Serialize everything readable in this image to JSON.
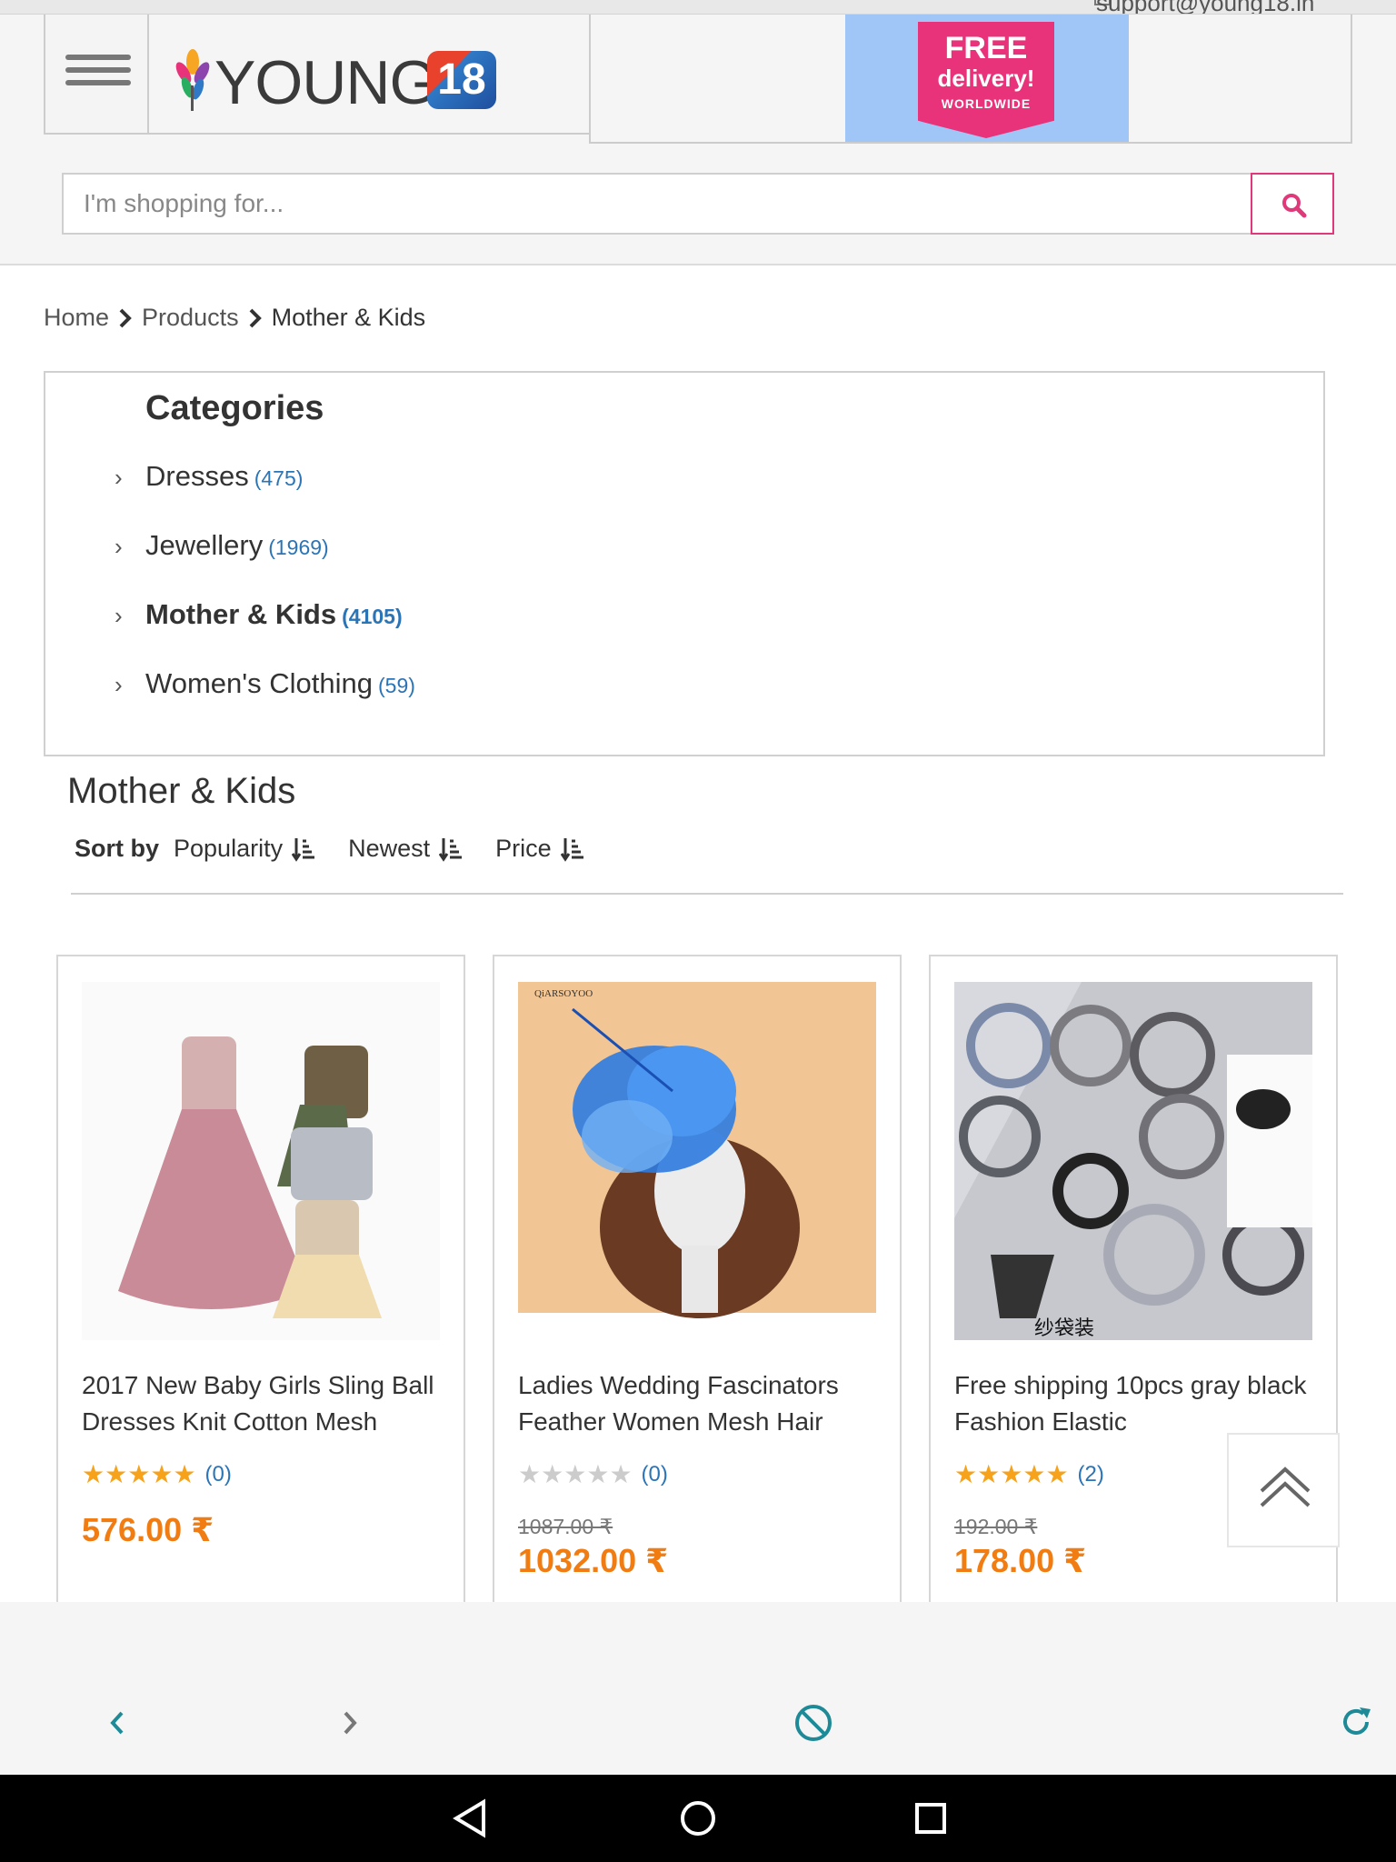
{
  "top_strip": {
    "email": "support@young18.in"
  },
  "header": {
    "logo_text": "YOUNG",
    "logo_badge": "18",
    "promo": {
      "line1": "FREE",
      "line2": "delivery!",
      "line3": "WORLDWIDE"
    },
    "search": {
      "placeholder": "I'm shopping for..."
    }
  },
  "breadcrumb": {
    "items": [
      "Home",
      "Products",
      "Mother & Kids"
    ]
  },
  "categories": {
    "title": "Categories",
    "items": [
      {
        "name": "Dresses",
        "count": "(475)"
      },
      {
        "name": "Jewellery",
        "count": "(1969)"
      },
      {
        "name": "Mother & Kids",
        "count": "(4105)"
      },
      {
        "name": "Women's Clothing",
        "count": "(59)"
      }
    ]
  },
  "section": {
    "title": "Mother & Kids",
    "sort_label": "Sort by",
    "sort_options": [
      "Popularity",
      "Newest",
      "Price"
    ]
  },
  "products": [
    {
      "name": "2017 New Baby Girls Sling Ball Dresses Knit Cotton Mesh",
      "rating_count": "(0)",
      "stars": 5,
      "old_price": "",
      "price": "576.00 ₹"
    },
    {
      "name": "Ladies Wedding Fascinators Feather Women Mesh Hair",
      "rating_count": "(0)",
      "stars": 0,
      "old_price": "1087.00 ₹",
      "price": "1032.00 ₹",
      "image_text": "QiARSOYOO"
    },
    {
      "name": "Free shipping 10pcs gray black Fashion Elastic",
      "rating_count": "(2)",
      "stars": 5,
      "old_price": "192.00 ₹",
      "price": "178.00 ₹",
      "image_text": "纱袋装"
    }
  ],
  "colors": {
    "accent": "#e0397a",
    "price": "#f07c12",
    "link": "#2b74b6",
    "browser_icon": "#1e8a97"
  },
  "icons": [
    "menu-icon",
    "search-icon",
    "chevron-right-icon",
    "sort-icon",
    "star-icon",
    "back-to-top-icon",
    "back-icon",
    "forward-icon",
    "stop-icon",
    "reload-icon"
  ]
}
